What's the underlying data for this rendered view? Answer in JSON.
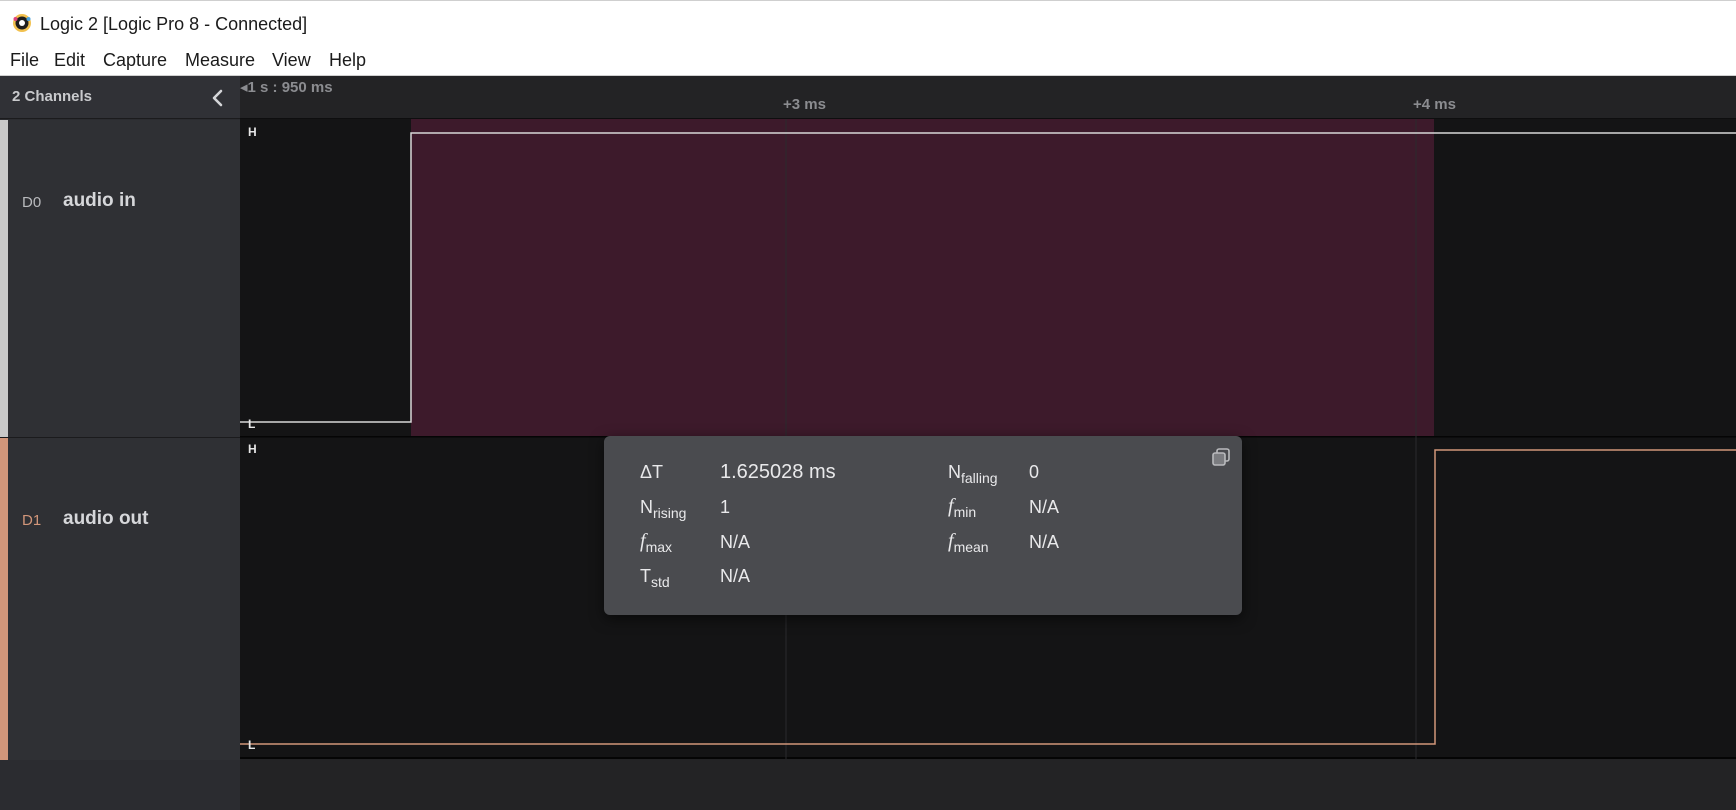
{
  "window": {
    "title": "Logic 2 [Logic Pro 8 - Connected]"
  },
  "menu": {
    "file": "File",
    "edit": "Edit",
    "capture": "Capture",
    "measure": "Measure",
    "view": "View",
    "help": "Help"
  },
  "sidebar": {
    "header": "2 Channels",
    "channels": [
      {
        "id": "D0",
        "name": "audio in",
        "color": "#c9c9c9"
      },
      {
        "id": "D1",
        "name": "audio out",
        "color": "#d2967a"
      }
    ]
  },
  "timeline": {
    "origin": "1 s : 950 ms",
    "ticks": [
      "+3 ms",
      "+4 ms"
    ]
  },
  "levels": {
    "high": "H",
    "low": "L"
  },
  "colors": {
    "selection": "#3d1a2b",
    "d0_trace": "#d8d8d8",
    "d1_trace": "#d2967a",
    "plot_bg": "#141415"
  },
  "measurement": {
    "delta_t": {
      "label": "ΔT",
      "value": "1.625028 ms"
    },
    "n_falling": {
      "label": "N",
      "sub": "falling",
      "value": "0"
    },
    "n_rising": {
      "label": "N",
      "sub": "rising",
      "value": "1"
    },
    "f_min": {
      "label": "f",
      "sub": "min",
      "value": "N/A"
    },
    "f_max": {
      "label": "f",
      "sub": "max",
      "value": "N/A"
    },
    "f_mean": {
      "label": "f",
      "sub": "mean",
      "value": "N/A"
    },
    "t_std": {
      "label": "T",
      "sub": "std",
      "value": "N/A"
    }
  }
}
